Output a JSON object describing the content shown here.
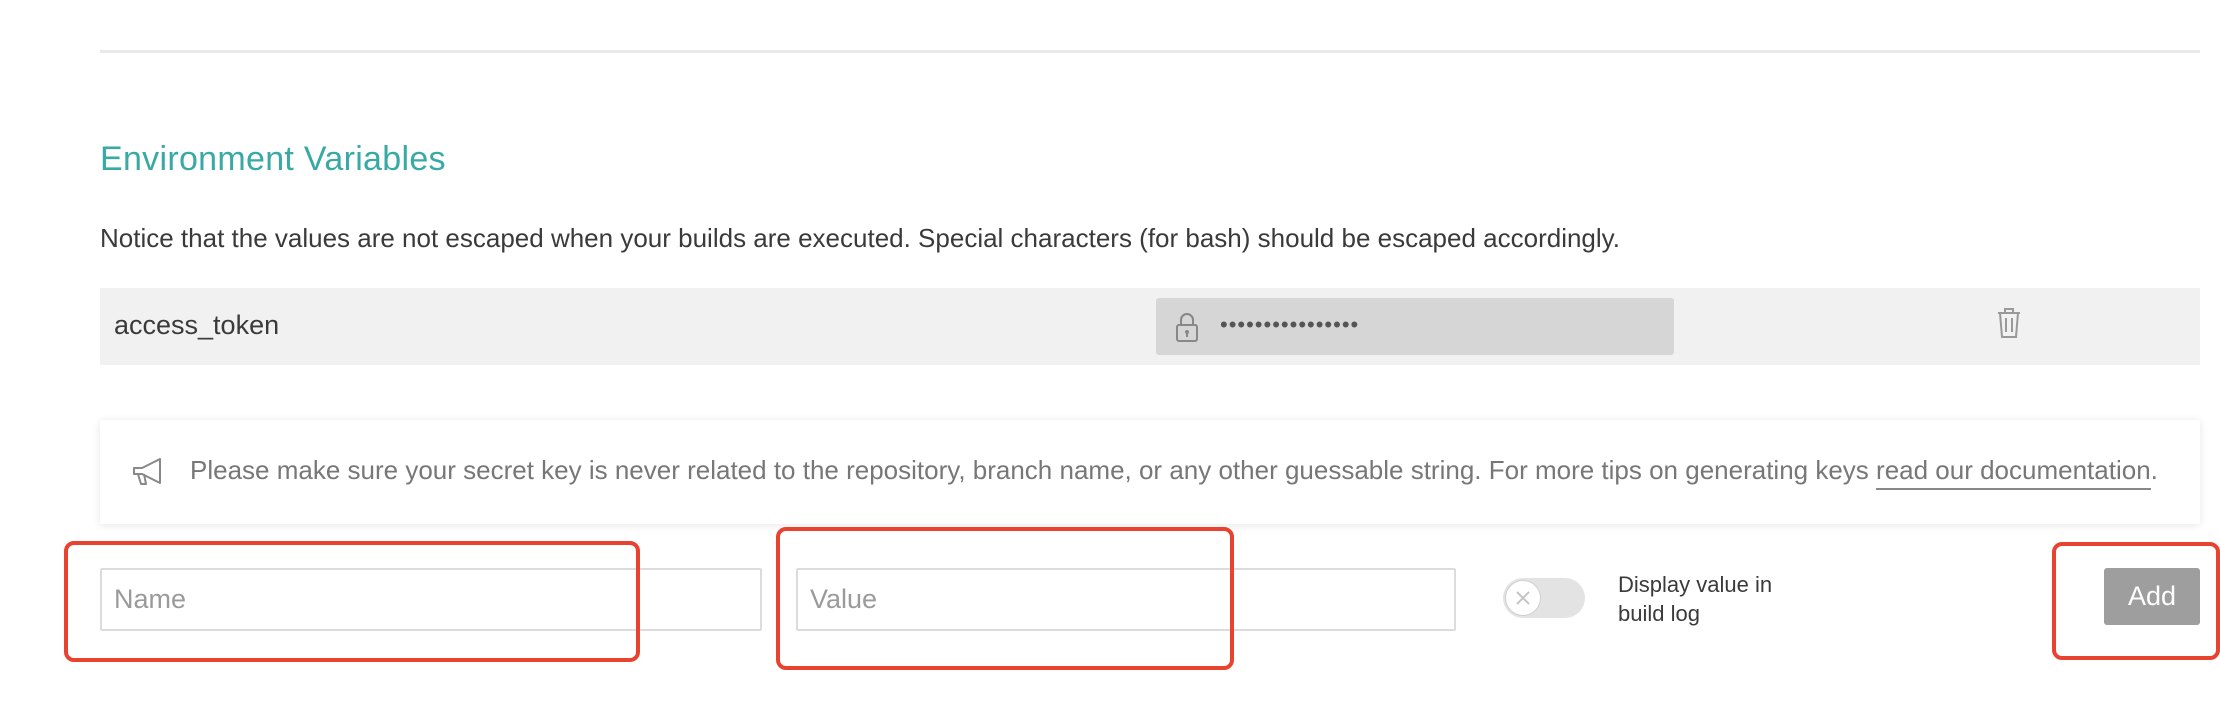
{
  "section": {
    "title": "Environment Variables",
    "notice": "Notice that the values are not escaped when your builds are executed. Special characters (for bash) should be escaped accordingly."
  },
  "env_vars": [
    {
      "name": "access_token",
      "value_masked": "••••••••••••••••"
    }
  ],
  "tip": {
    "text": "Please make sure your secret key is never related to the repository, branch name, or any other guessable string. For more tips on generating keys ",
    "link_label": "read our documentation",
    "suffix": "."
  },
  "form": {
    "name_placeholder": "Name",
    "value_placeholder": "Value",
    "toggle_label": "Display value in build log",
    "toggle_on": false,
    "add_label": "Add"
  },
  "colors": {
    "accent": "#39a9a5",
    "highlight": "#e8432f",
    "add_button": "#9e9e9e"
  },
  "icons": {
    "lock": "lock-icon",
    "trash": "trash-icon",
    "megaphone": "megaphone-icon",
    "toggle_off": "close-icon"
  }
}
